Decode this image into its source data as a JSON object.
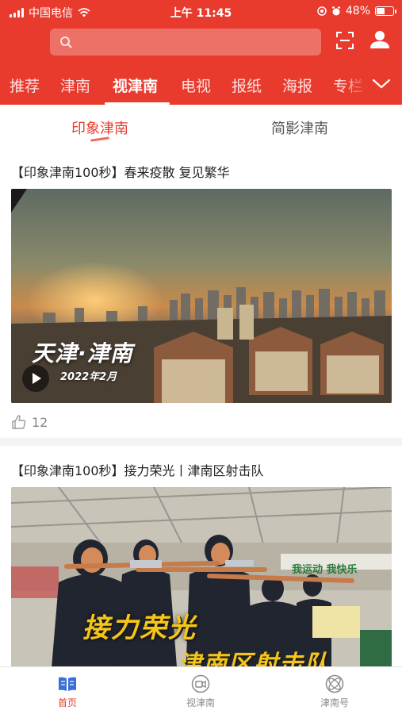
{
  "status_bar": {
    "carrier": "中国电信",
    "time": "上午 11:45",
    "battery": "48%",
    "battery_level": 0.48
  },
  "header": {
    "search_placeholder": "",
    "top_tabs": [
      {
        "label": "推荐"
      },
      {
        "label": "津南"
      },
      {
        "label": "视津南",
        "active": true
      },
      {
        "label": "电视"
      },
      {
        "label": "报纸"
      },
      {
        "label": "海报"
      },
      {
        "label": "专栏"
      }
    ]
  },
  "sub_tabs": [
    {
      "label": "印象津南",
      "active": true
    },
    {
      "label": "简影津南"
    }
  ],
  "feed": [
    {
      "title": "【印象津南100秒】春来疫散 复见繁华",
      "overlay_title": "天津·津南",
      "overlay_date": "2022年2月",
      "likes": "12"
    },
    {
      "title": "【印象津南100秒】接力荣光丨津南区射击队",
      "overlay_line1": "接力荣光",
      "overlay_line2": "津南区射击队",
      "banner_text": "我运动 我快乐"
    }
  ],
  "bottom_nav": [
    {
      "label": "首页",
      "icon": "book-icon",
      "active": true
    },
    {
      "label": "视津南",
      "icon": "video-camera-icon"
    },
    {
      "label": "津南号",
      "icon": "orbit-icon"
    }
  ],
  "colors": {
    "brand_red": "#e83b2e",
    "overlay_yellow": "#f5c518"
  }
}
